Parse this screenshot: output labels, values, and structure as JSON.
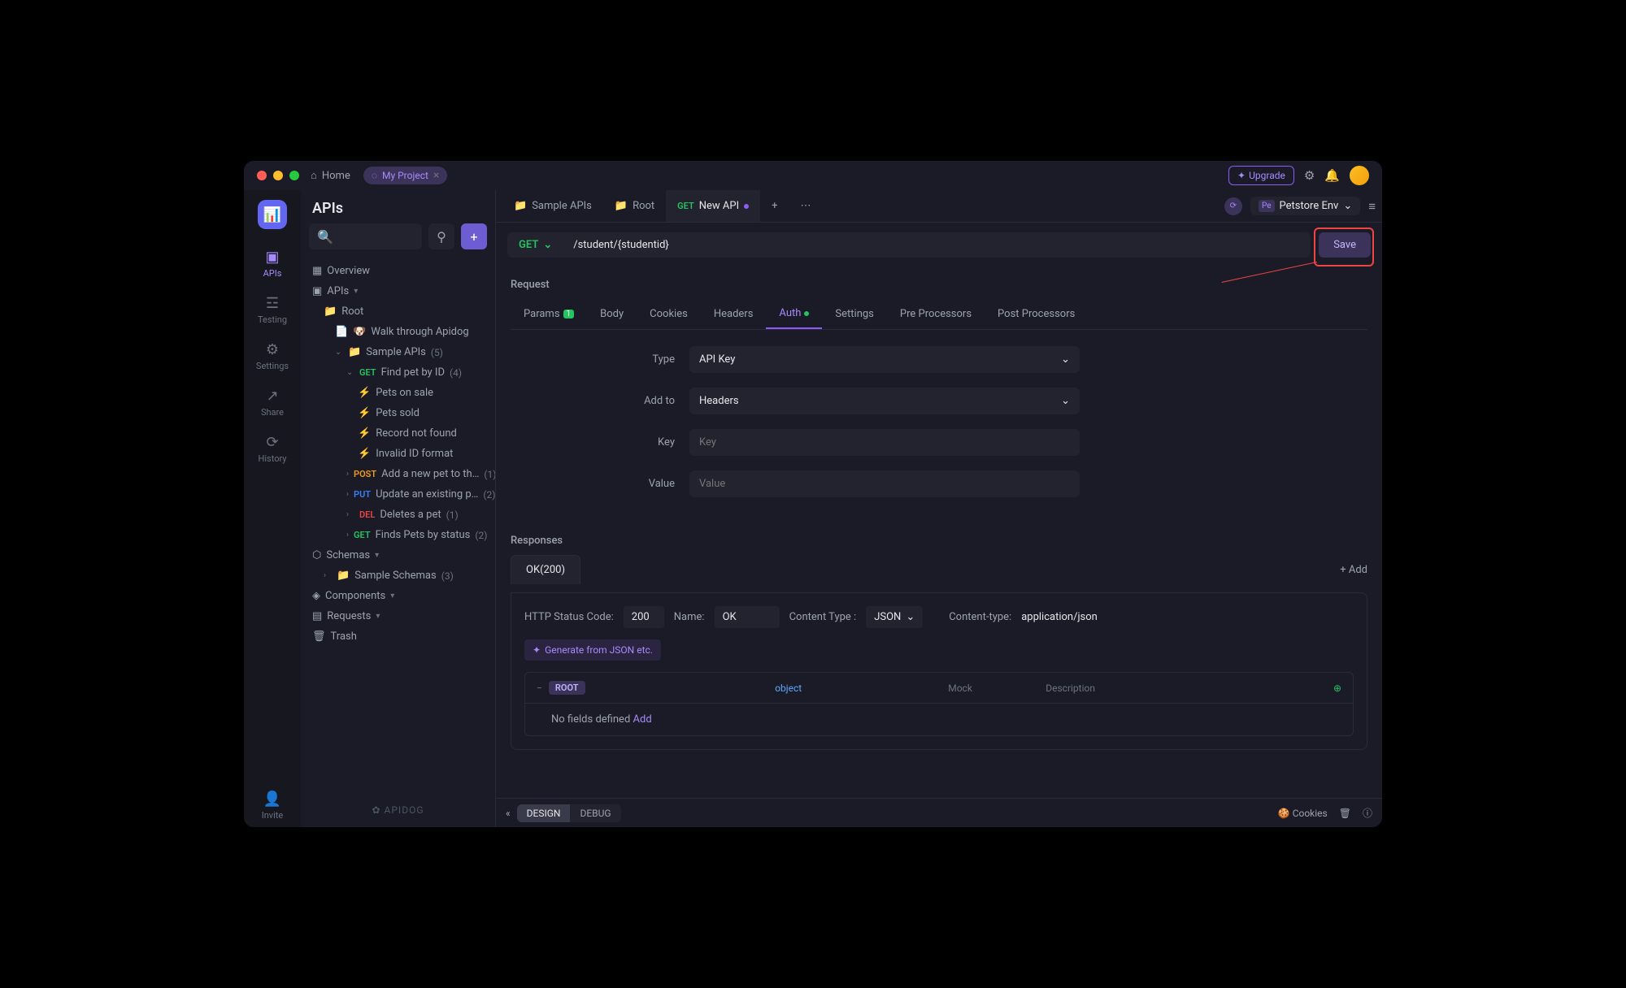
{
  "titlebar": {
    "home": "Home",
    "project": "My Project",
    "upgrade": "Upgrade"
  },
  "rail": {
    "apis": "APIs",
    "testing": "Testing",
    "settings": "Settings",
    "share": "Share",
    "history": "History",
    "invite": "Invite"
  },
  "sidebar": {
    "title": "APIs",
    "overview": "Overview",
    "apis_section": "APIs",
    "root": "Root",
    "walkthrough": "Walk through Apidog",
    "sample_apis": "Sample APIs",
    "sample_count": "(5)",
    "find_pet": "Find pet by ID",
    "find_pet_count": "(4)",
    "pets_sale": "Pets on sale",
    "pets_sold": "Pets sold",
    "record_nf": "Record not found",
    "invalid_id": "Invalid ID format",
    "add_pet": "Add a new pet to th…",
    "add_pet_count": "(1)",
    "update_pet": "Update an existing p…",
    "update_pet_count": "(2)",
    "delete_pet": "Deletes a pet",
    "delete_pet_count": "(1)",
    "finds_status": "Finds Pets by status",
    "finds_status_count": "(2)",
    "schemas": "Schemas",
    "sample_schemas": "Sample Schemas",
    "sample_schemas_count": "(3)",
    "components": "Components",
    "requests": "Requests",
    "trash": "Trash",
    "footer": "APIDOG"
  },
  "tabs": {
    "sample": "Sample APIs",
    "root": "Root",
    "new_api": "New API",
    "method": "GET",
    "env": "Petstore Env",
    "env_badge": "Pe"
  },
  "url": {
    "method": "GET",
    "path": "/student/{studentid}",
    "save": "Save"
  },
  "request": {
    "label": "Request",
    "tabs": {
      "params": "Params",
      "params_badge": "1",
      "body": "Body",
      "cookies": "Cookies",
      "headers": "Headers",
      "auth": "Auth",
      "settings": "Settings",
      "pre": "Pre Processors",
      "post": "Post Processors"
    },
    "type_label": "Type",
    "type_value": "API Key",
    "addto_label": "Add to",
    "addto_value": "Headers",
    "key_label": "Key",
    "key_placeholder": "Key",
    "value_label": "Value",
    "value_placeholder": "Value"
  },
  "responses": {
    "label": "Responses",
    "tab": "OK(200)",
    "add": "Add",
    "status_label": "HTTP Status Code:",
    "status_value": "200",
    "name_label": "Name:",
    "name_value": "OK",
    "ct_label": "Content Type :",
    "ct_value": "JSON",
    "cth_label": "Content-type:",
    "cth_value": "application/json",
    "gen": "Generate from JSON etc.",
    "root": "ROOT",
    "root_type": "object",
    "mock": "Mock",
    "desc": "Description",
    "nofields": "No fields defined",
    "add2": "Add"
  },
  "bottom": {
    "design": "DESIGN",
    "debug": "DEBUG",
    "cookies": "Cookies"
  }
}
